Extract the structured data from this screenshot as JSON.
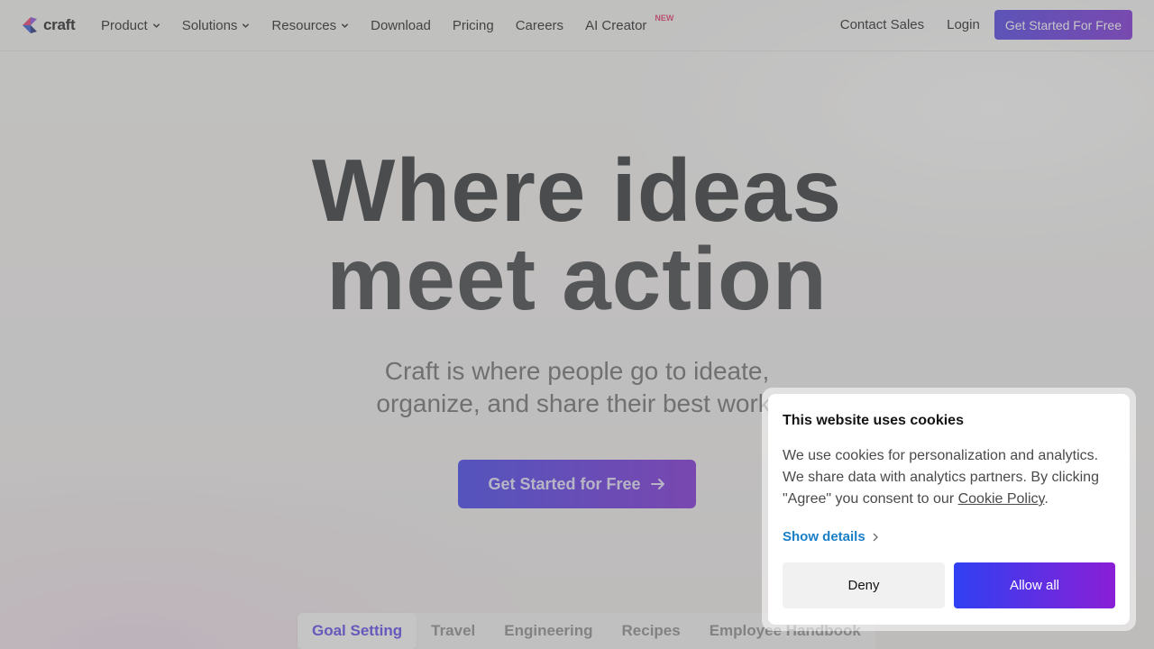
{
  "brand": {
    "name": "craft"
  },
  "nav": {
    "items": [
      {
        "label": "Product",
        "has_dropdown": true
      },
      {
        "label": "Solutions",
        "has_dropdown": true
      },
      {
        "label": "Resources",
        "has_dropdown": true
      },
      {
        "label": "Download",
        "has_dropdown": false
      },
      {
        "label": "Pricing",
        "has_dropdown": false
      },
      {
        "label": "Careers",
        "has_dropdown": false
      },
      {
        "label": "AI Creator",
        "has_dropdown": false,
        "badge": "NEW"
      }
    ],
    "contact_label": "Contact Sales",
    "login_label": "Login",
    "cta_label": "Get Started For Free"
  },
  "hero": {
    "title_line1": "Where ideas",
    "title_line2": "meet action",
    "subtitle_line1": "Craft is where people go to ideate,",
    "subtitle_line2": "organize, and share their best work.",
    "cta_label": "Get Started for Free",
    "cta_icon": "arrow-right-icon"
  },
  "tabs": [
    {
      "label": "Goal Setting",
      "active": true
    },
    {
      "label": "Travel",
      "active": false
    },
    {
      "label": "Engineering",
      "active": false
    },
    {
      "label": "Recipes",
      "active": false
    },
    {
      "label": "Employee Handbook",
      "active": false
    }
  ],
  "cookie": {
    "title": "This website uses cookies",
    "body_text": "We use cookies for personalization and analytics. We share data with analytics partners. By clicking \"Agree\" you consent to our ",
    "link_label": "Cookie Policy",
    "body_end": ".",
    "details_label": "Show details",
    "deny_label": "Deny",
    "allow_label": "Allow all"
  },
  "colors": {
    "accent_start": "#4a3ae6",
    "accent_end": "#7a2ad9",
    "badge": "#e8366c",
    "link": "#1a7fc6"
  }
}
